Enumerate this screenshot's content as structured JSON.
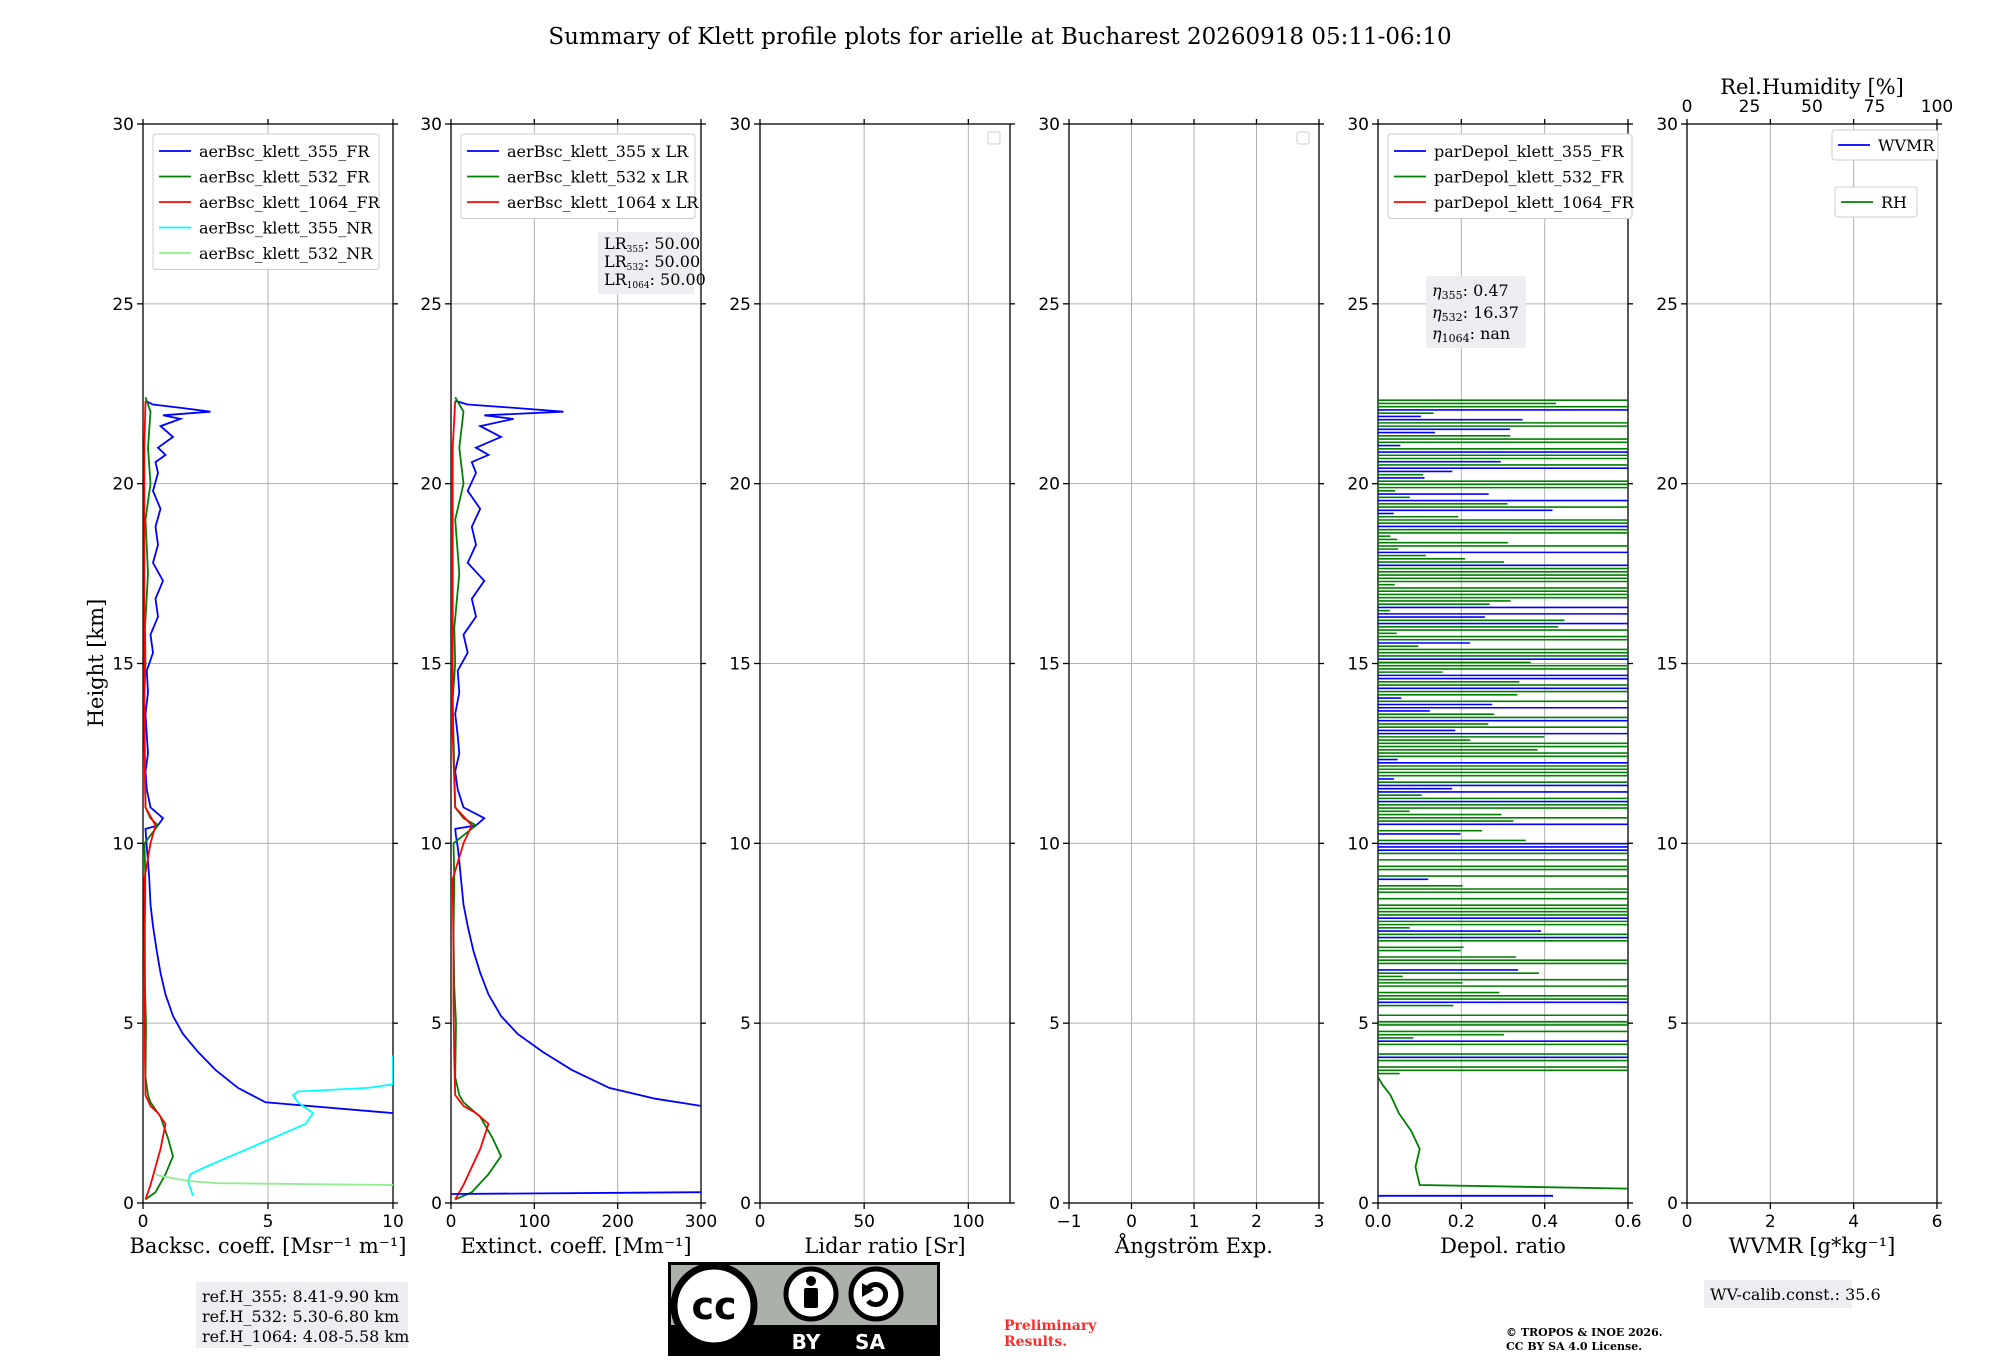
{
  "title": "Summary of Klett profile plots for arielle at Bucharest 20260918 05:11-06:10",
  "height_label": "Height [km]",
  "panels": [
    {
      "key": "bsc",
      "xlabel": "Backsc. coeff. [Msr⁻¹ m⁻¹]",
      "xlim": [
        0,
        10
      ],
      "xticks": [
        "0",
        "5",
        "10"
      ],
      "legend": [
        "aerBsc_klett_355_FR",
        "aerBsc_klett_532_FR",
        "aerBsc_klett_1064_FR",
        "aerBsc_klett_355_NR",
        "aerBsc_klett_532_NR"
      ]
    },
    {
      "key": "ext",
      "xlabel": "Extinct. coeff. [Mm⁻¹]",
      "xlim": [
        0,
        300
      ],
      "xticks": [
        "0",
        "100",
        "200",
        "300"
      ],
      "legend": [
        "aerBsc_klett_355 x LR",
        "aerBsc_klett_532 x LR",
        "aerBsc_klett_1064 x LR"
      ]
    },
    {
      "key": "lr",
      "xlabel": "Lidar ratio [Sr]",
      "xlim": [
        0,
        120
      ],
      "xticks": [
        "0",
        "50",
        "100"
      ],
      "legend": []
    },
    {
      "key": "ang",
      "xlabel": "Ångström Exp.",
      "xlim": [
        -1,
        3
      ],
      "xticks": [
        "−1",
        "0",
        "1",
        "2",
        "3"
      ],
      "legend": []
    },
    {
      "key": "dep",
      "xlabel": "Depol. ratio",
      "xlim": [
        0,
        0.6
      ],
      "xticks": [
        "0.0",
        "0.2",
        "0.4",
        "0.6"
      ],
      "legend": [
        "parDepol_klett_355_FR",
        "parDepol_klett_532_FR",
        "parDepol_klett_1064_FR"
      ]
    },
    {
      "key": "wv",
      "xlabel": "WVMR [g*kg⁻¹]",
      "xlim": [
        0,
        6
      ],
      "xticks": [
        "0",
        "2",
        "4",
        "6"
      ],
      "legend": [
        "WVMR",
        "RH"
      ],
      "top_label": "Rel.Humidity [%]",
      "top_xlim": [
        0,
        100
      ],
      "top_ticks": [
        "0",
        "25",
        "50",
        "75",
        "100"
      ]
    }
  ],
  "height_ticks": [
    "0",
    "5",
    "10",
    "15",
    "20",
    "25",
    "30"
  ],
  "ylim": [
    0,
    30
  ],
  "lr_box": [
    "LR",
    "355",
    ": 50.00",
    "532",
    ": 50.00",
    "1064",
    ": 50.00"
  ],
  "eta_box": [
    "η",
    "355",
    ": 0.47",
    "532",
    ": 16.37",
    "1064",
    ": nan"
  ],
  "ref_box": [
    "ref.H_355: 8.41-9.90 km",
    "ref.H_532: 5.30-6.80 km",
    "ref.H_1064: 4.08-5.58 km"
  ],
  "wv_calib": "WV-calib.const.: 35.6",
  "preliminary": [
    "Preliminary",
    "Results."
  ],
  "copyright": [
    "© TROPOS & INOE 2026.",
    "CC BY SA 4.0 License."
  ],
  "cc_badge": [
    "cc",
    "BY",
    "SA"
  ],
  "colors": {
    "c355": "#0000ff",
    "c532": "#008000",
    "c1064": "#ff0000",
    "c355nr": "#00ffff",
    "c532nr": "#90ee90",
    "grid": "#b0b0b0",
    "legend_box": "#cccccc"
  },
  "chart_data": {
    "type": "line",
    "ylim": [
      0,
      30
    ],
    "backscatter": {
      "xlim": [
        0,
        10
      ],
      "series": [
        {
          "name": "aerBsc_klett_355_FR",
          "color": "#0000ff",
          "x": [
            10,
            4.9,
            3.8,
            2.9,
            2.2,
            1.6,
            1.2,
            0.9,
            0.7,
            0.55,
            0.4,
            0.3,
            0.25,
            0.2,
            0.15,
            0.12,
            0.1,
            0.6,
            0.8,
            0.3,
            0.15,
            0.1,
            0.2,
            0.15,
            0.1,
            0.2,
            0.15,
            0.4,
            0.3,
            0.6,
            0.5,
            0.8,
            0.4,
            0.6,
            0.5,
            0.7,
            0.4,
            0.6,
            0.5,
            0.9,
            0.6,
            1.2,
            0.7,
            1.5,
            0.8,
            2.7,
            1.6,
            0.4,
            0.1
          ],
          "y": [
            2.5,
            2.8,
            3.2,
            3.7,
            4.2,
            4.7,
            5.2,
            5.8,
            6.4,
            7.0,
            7.7,
            8.3,
            9.0,
            9.5,
            9.9,
            10.2,
            10.4,
            10.5,
            10.7,
            11.0,
            11.5,
            12.0,
            12.5,
            13.0,
            13.6,
            14.2,
            14.8,
            15.3,
            15.8,
            16.3,
            16.8,
            17.3,
            17.8,
            18.3,
            18.8,
            19.3,
            19.8,
            20.3,
            20.6,
            20.8,
            21.0,
            21.3,
            21.6,
            21.8,
            21.9,
            22.0,
            22.1,
            22.2,
            22.3
          ]
        },
        {
          "name": "aerBsc_klett_532_FR",
          "color": "#008000",
          "x": [
            0.1,
            0.5,
            0.9,
            1.2,
            1.0,
            0.8,
            0.7,
            0.5,
            0.3,
            0.2,
            0.1,
            0.12,
            0.08,
            0.07,
            0.09,
            0.06,
            0.6,
            0.3,
            0.1,
            0.08,
            0.07,
            0.05,
            0.1,
            0.08,
            0.2,
            0.1,
            0.3,
            0.2,
            0.3,
            0.1
          ],
          "y": [
            0.1,
            0.3,
            0.8,
            1.3,
            1.8,
            2.2,
            2.4,
            2.6,
            2.8,
            3.0,
            3.5,
            5.0,
            6.0,
            7.5,
            9.0,
            10.0,
            10.5,
            10.7,
            11.0,
            12.0,
            13.0,
            14.0,
            15.0,
            16.0,
            17.5,
            19.0,
            20.0,
            21.0,
            22.0,
            22.4
          ]
        },
        {
          "name": "aerBsc_klett_1064_FR",
          "color": "#ff0000",
          "x": [
            0.1,
            0.3,
            0.5,
            0.7,
            0.9,
            0.6,
            0.3,
            0.1,
            0.08,
            0.07,
            0.06,
            0.05,
            0.3,
            0.5,
            0.1,
            0.05,
            0.05,
            0.05,
            0.05,
            0.1
          ],
          "y": [
            0.1,
            0.5,
            1.0,
            1.5,
            2.2,
            2.5,
            2.7,
            3.0,
            4.0,
            5.5,
            7.0,
            9.0,
            10.0,
            10.5,
            11.0,
            13.0,
            16.0,
            19.0,
            21.0,
            22.3
          ]
        },
        {
          "name": "aerBsc_klett_355_NR",
          "color": "#00ffff",
          "x": [
            2.0,
            1.9,
            1.8,
            1.9,
            2.5,
            3.5,
            4.5,
            5.5,
            6.5,
            6.8,
            6.2,
            6.0,
            6.2,
            9.0,
            10,
            10,
            10,
            10
          ],
          "y": [
            0.2,
            0.4,
            0.6,
            0.8,
            1.0,
            1.3,
            1.6,
            1.9,
            2.2,
            2.5,
            2.8,
            3.0,
            3.1,
            3.2,
            3.3,
            4.0,
            4.1,
            4.1
          ]
        },
        {
          "name": "aerBsc_klett_532_NR",
          "color": "#90ee90",
          "x": [
            10,
            3.0,
            2.0,
            1.5,
            1.1,
            0.7,
            0.5
          ],
          "y": [
            0.5,
            0.55,
            0.6,
            0.65,
            0.7,
            0.75,
            0.8
          ]
        }
      ]
    },
    "extinction": {
      "xlim": [
        0,
        300
      ],
      "lr": 50,
      "series": [
        {
          "name": "aerBsc_klett_355 x LR",
          "color": "#0000ff",
          "x": [
            300,
            245,
            190,
            145,
            110,
            80,
            60,
            45,
            35,
            27,
            20,
            15,
            12,
            10,
            8,
            6,
            5,
            30,
            40,
            15,
            8,
            5,
            10,
            8,
            5,
            10,
            8,
            20,
            15,
            30,
            25,
            40,
            20,
            30,
            25,
            35,
            20,
            30,
            25,
            45,
            30,
            60,
            35,
            75,
            40,
            135,
            80,
            20,
            5
          ],
          "y": [
            2.7,
            2.9,
            3.2,
            3.7,
            4.2,
            4.7,
            5.2,
            5.8,
            6.4,
            7.0,
            7.7,
            8.3,
            9.0,
            9.5,
            9.9,
            10.2,
            10.4,
            10.5,
            10.7,
            11.0,
            11.5,
            12.0,
            12.5,
            13.0,
            13.6,
            14.2,
            14.8,
            15.3,
            15.8,
            16.3,
            16.8,
            17.3,
            17.8,
            18.3,
            18.8,
            19.3,
            19.8,
            20.3,
            20.6,
            20.8,
            21.0,
            21.3,
            21.6,
            21.8,
            21.9,
            22.0,
            22.1,
            22.2,
            22.3
          ]
        },
        {
          "name": "aerBsc_klett_532 x LR",
          "color": "#008000",
          "x": [
            5,
            25,
            45,
            60,
            50,
            40,
            35,
            25,
            15,
            10,
            5,
            6,
            4,
            3,
            4,
            3,
            30,
            15,
            5,
            4,
            3,
            2,
            5,
            4,
            10,
            5,
            15,
            10,
            15,
            5
          ],
          "y": [
            0.1,
            0.3,
            0.8,
            1.3,
            1.8,
            2.2,
            2.4,
            2.6,
            2.8,
            3.0,
            3.5,
            5.0,
            6.0,
            7.5,
            9.0,
            10.0,
            10.5,
            10.7,
            11.0,
            12.0,
            13.0,
            14.0,
            15.0,
            16.0,
            17.5,
            19.0,
            20.0,
            21.0,
            22.0,
            22.4
          ]
        },
        {
          "name": "aerBsc_klett_1064 x LR",
          "color": "#ff0000",
          "x": [
            5,
            15,
            25,
            35,
            45,
            30,
            15,
            5,
            4,
            3,
            3,
            2,
            15,
            25,
            5,
            2,
            2,
            2,
            2,
            5
          ],
          "y": [
            0.1,
            0.5,
            1.0,
            1.5,
            2.2,
            2.5,
            2.7,
            3.0,
            4.0,
            5.5,
            7.0,
            9.0,
            10.0,
            10.5,
            11.0,
            13.0,
            16.0,
            19.0,
            21.0,
            22.3
          ]
        },
        {
          "name": "aerBsc_klett_355 x LR (near-ground)",
          "color": "#0000ff",
          "x": [
            300,
            0
          ],
          "y": [
            0.3,
            0.25
          ]
        }
      ]
    },
    "depol": {
      "xlim": [
        0,
        0.6
      ],
      "series": [
        {
          "name": "parDepol_klett_532_FR",
          "color": "#008000",
          "x": [
            0.6,
            0.1,
            0.09,
            0.1,
            0.08,
            0.05,
            0.03,
            0.01,
            0.0
          ],
          "y": [
            0.4,
            0.5,
            1.0,
            1.5,
            2.0,
            2.5,
            3.0,
            3.3,
            3.5
          ]
        },
        {
          "name": "parDepol_klett_355_FR",
          "color": "#0000ff",
          "x": [
            0.42,
            0.0
          ],
          "y": [
            0.2,
            0.2
          ]
        }
      ]
    },
    "wv": {
      "xlim": [
        0,
        6
      ],
      "series": []
    }
  }
}
